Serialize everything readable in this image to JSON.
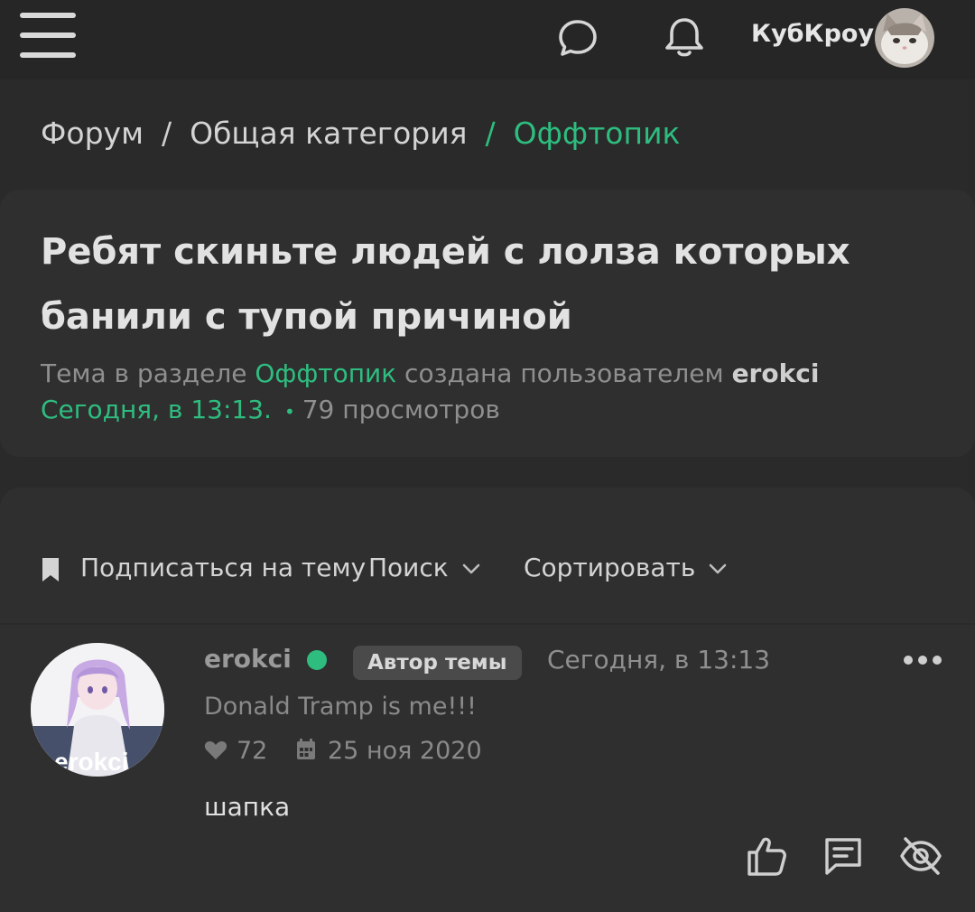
{
  "header": {
    "menu_icon": "hamburger-menu-icon",
    "chat_icon": "chat-bubble-icon",
    "bell_icon": "bell-icon",
    "username": "КубКроу"
  },
  "breadcrumb": {
    "items": [
      "Форум",
      "Общая категория",
      "Оффтопик"
    ],
    "separator": "/"
  },
  "thread": {
    "title": "Ребят скиньте людей с лолза которых банили с тупой причиной",
    "meta_prefix": "Тема в разделе",
    "section": "Оффтопик",
    "meta_middle": "создана пользователем",
    "author": "erokci",
    "created": "Сегодня, в 13:13.",
    "dot": "•",
    "views": "79 просмотров"
  },
  "toolbar": {
    "subscribe_label": "Подписаться на тему",
    "search_label": "Поиск",
    "sort_label": "Сортировать"
  },
  "post": {
    "author": "erokci",
    "badge": "Автор темы",
    "time": "Сегодня, в 13:13",
    "user_title": "Donald Tramp is me!!!",
    "likes": "72",
    "registered": "25 ноя 2020",
    "body": "шапка",
    "avatar_text": "erokci"
  },
  "colors": {
    "accent": "#2ebd7f",
    "background": "#2a2a2a",
    "card": "#2f2f2f",
    "topbar": "#262626"
  }
}
